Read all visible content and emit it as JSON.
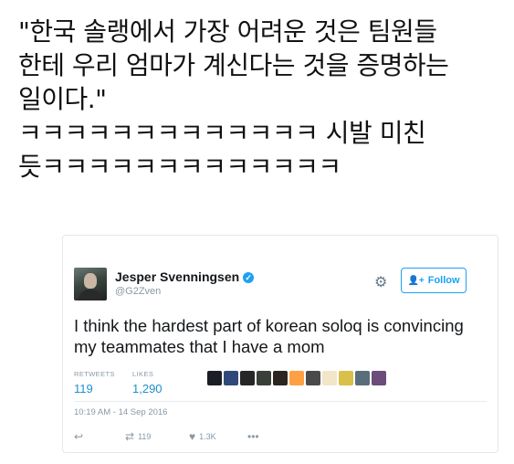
{
  "caption": {
    "lines": [
      "\"한국 솔랭에서 가장 어려운 것은 팀원들",
      "한테 우리 엄마가 계신다는 것을 증명하는",
      "일이다.\"",
      "ㅋㅋㅋㅋㅋㅋㅋㅋㅋㅋㅋㅋㅋ 시발 미친",
      "듯ㅋㅋㅋㅋㅋㅋㅋㅋㅋㅋㅋㅋㅋ"
    ]
  },
  "tweet": {
    "author_name": "Jesper Svenningsen",
    "verified_glyph": "✓",
    "handle": "@G2Zven",
    "follow_label": "Follow",
    "follow_glyph": "👤+",
    "gear_glyph": "⚙",
    "text": "I think the hardest part of korean soloq is convincing my teammates that I have a mom",
    "retweets_label": "RETWEETS",
    "retweets_count": "119",
    "likes_label": "LIKES",
    "likes_count": "1,290",
    "timestamp": "10:19 AM - 14 Sep 2016",
    "actions": {
      "reply_glyph": "↩",
      "retweet_glyph": "⇄",
      "retweet_count": "119",
      "like_glyph": "♥",
      "like_count": "1.3K",
      "more_glyph": "•••"
    },
    "liker_colors": [
      "#1b1e26",
      "#2f4a7a",
      "#262626",
      "#3a3f3a",
      "#2b2420",
      "#ff9f43",
      "#4a4a4a",
      "#f2e6c9",
      "#d9c04a",
      "#5a6d7a",
      "#6b4c7a"
    ]
  }
}
